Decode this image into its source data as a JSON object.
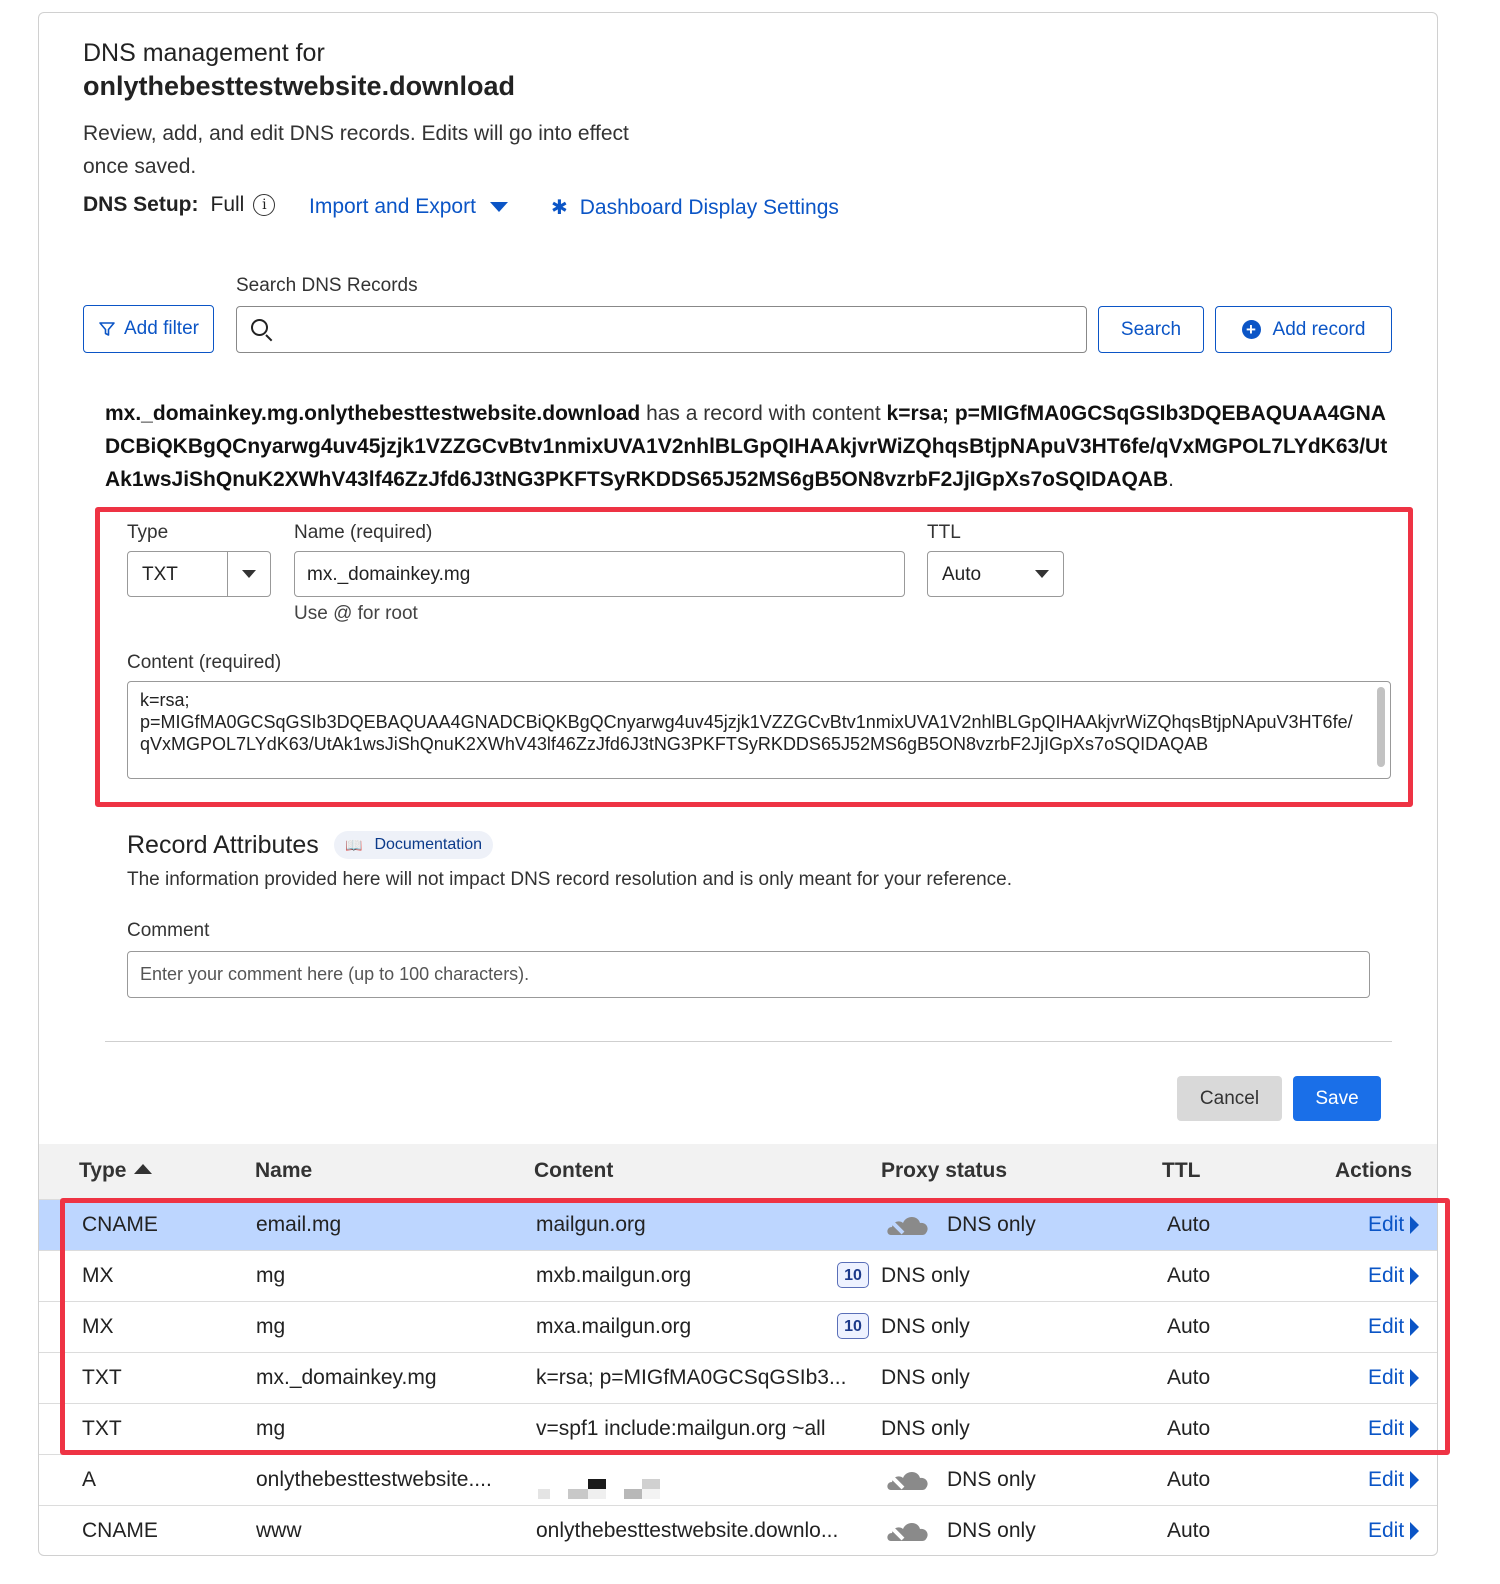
{
  "header": {
    "title_prefix": "DNS management for",
    "domain": "onlythebesttestwebsite.download",
    "description": "Review, add, and edit DNS records. Edits will go into effect once saved.",
    "setup_label": "DNS Setup:",
    "setup_value": "Full",
    "import_export": "Import and Export",
    "dashboard_settings": "Dashboard Display Settings"
  },
  "toolbar": {
    "search_label": "Search DNS Records",
    "add_filter": "Add filter",
    "search_button": "Search",
    "add_record": "Add record",
    "search_value": ""
  },
  "summary": {
    "record_name": "mx._domainkey.mg.onlythebesttestwebsite.download",
    "middle": " has a record with content ",
    "content": "k=rsa; p=MIGfMA0GCSqGSIb3DQEBAQUAA4GNADCBiQKBgQCnyarwg4uv45jzjk1VZZGCvBtv1nmixUVA1V2nhlBLGpQIHAAkjvrWiZQhqsBtjpNApuV3HT6fe/qVxMGPOL7LYdK63/UtAk1wsJiShQnuK2XWhV43lf46ZzJfd6J3tNG3PKFTSyRKDDS65J52MS6gB5ON8vzrbF2JjIGpXs7oSQIDAQAB",
    "end": "."
  },
  "form": {
    "type_label": "Type",
    "type_value": "TXT",
    "name_label": "Name (required)",
    "name_value": "mx._domainkey.mg",
    "name_hint": "Use @ for root",
    "ttl_label": "TTL",
    "ttl_value": "Auto",
    "content_label": "Content (required)",
    "content_value": "k=rsa;\np=MIGfMA0GCSqGSIb3DQEBAQUAA4GNADCBiQKBgQCnyarwg4uv45jzjk1VZZGCvBtv1nmixUVA1V2nhlBLGpQIHAAkjvrWiZQhqsBtjpNApuV3HT6fe/qVxMGPOL7LYdK63/UtAk1wsJiShQnuK2XWhV43lf46ZzJfd6J3tNG3PKFTSyRKDDS65J52MS6gB5ON8vzrbF2JjIGpXs7oSQIDAQAB"
  },
  "attributes": {
    "title": "Record Attributes",
    "doc_badge": "Documentation",
    "description": "The information provided here will not impact DNS record resolution and is only meant for your reference.",
    "comment_label": "Comment",
    "comment_placeholder": "Enter your comment here (up to 100 characters)."
  },
  "actions": {
    "cancel": "Cancel",
    "save": "Save"
  },
  "table": {
    "headers": {
      "type": "Type",
      "name": "Name",
      "content": "Content",
      "proxy": "Proxy status",
      "ttl": "TTL",
      "actions": "Actions"
    },
    "rows": [
      {
        "type": "CNAME",
        "name": "email.mg",
        "content": "mailgun.org",
        "priority": "",
        "proxy": "DNS only",
        "ttl": "Auto",
        "action": "Edit"
      },
      {
        "type": "MX",
        "name": "mg",
        "content": "mxb.mailgun.org",
        "priority": "10",
        "proxy": "DNS only",
        "ttl": "Auto",
        "action": "Edit"
      },
      {
        "type": "MX",
        "name": "mg",
        "content": "mxa.mailgun.org",
        "priority": "10",
        "proxy": "DNS only",
        "ttl": "Auto",
        "action": "Edit"
      },
      {
        "type": "TXT",
        "name": "mx._domainkey.mg",
        "content": "k=rsa; p=MIGfMA0GCSqGSIb3...",
        "priority": "",
        "proxy": "DNS only",
        "ttl": "Auto",
        "action": "Edit"
      },
      {
        "type": "TXT",
        "name": "mg",
        "content": "v=spf1 include:mailgun.org ~all",
        "priority": "",
        "proxy": "DNS only",
        "ttl": "Auto",
        "action": "Edit"
      },
      {
        "type": "A",
        "name": "onlythebesttestwebsite....",
        "content": "",
        "priority": "",
        "proxy": "DNS only",
        "ttl": "Auto",
        "action": "Edit"
      },
      {
        "type": "CNAME",
        "name": "www",
        "content": "onlythebesttestwebsite.downlo...",
        "priority": "",
        "proxy": "DNS only",
        "ttl": "Auto",
        "action": "Edit"
      }
    ]
  },
  "icons": {
    "filter": "filter-icon",
    "search": "search-icon",
    "info": "info-icon",
    "gear": "gear-icon",
    "plus": "plus-circle-icon",
    "book": "book-icon",
    "cloud": "cloud-icon"
  },
  "colors": {
    "accent": "#0b55c6",
    "save": "#1a6fe8",
    "highlight": "#ee3344",
    "selected_row": "#bdd6ff"
  }
}
